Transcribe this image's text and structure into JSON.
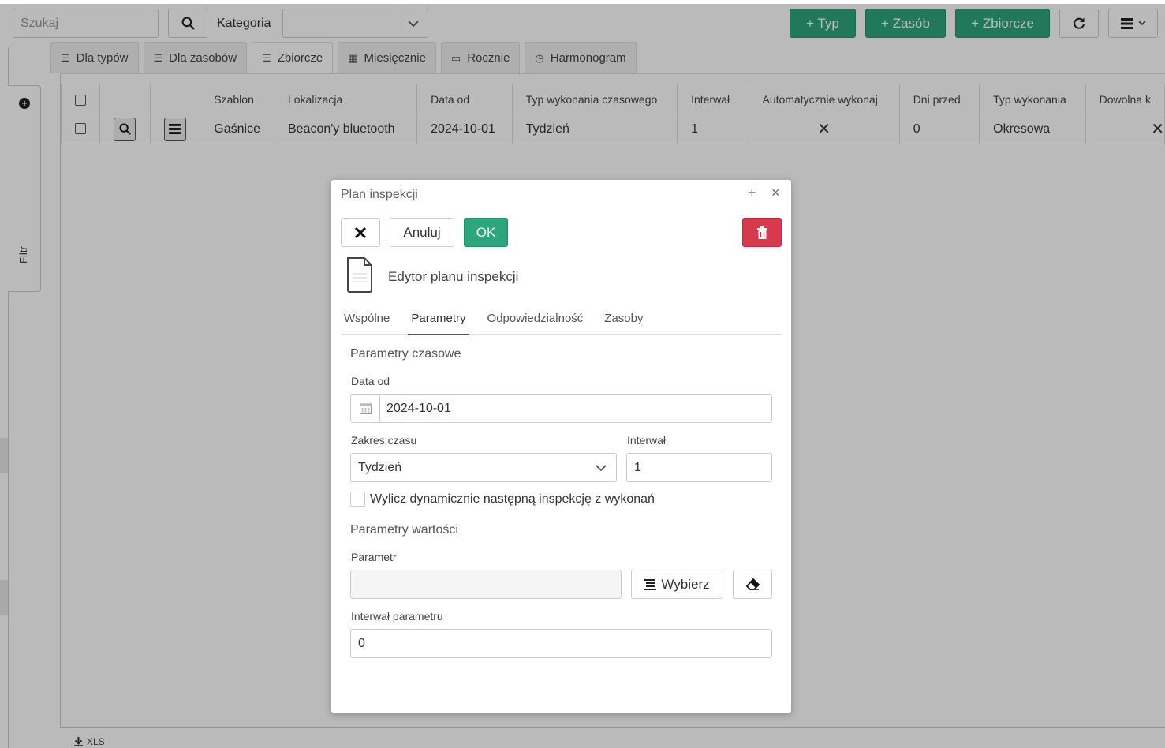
{
  "toolbar": {
    "search_placeholder": "Szukaj",
    "category_label": "Kategoria",
    "category_value": "",
    "add_type_label": "+ Typ",
    "add_resource_label": "+ Zasób",
    "add_collective_label": "+ Zbiorcze"
  },
  "sidebar": {
    "filter_label": "Filtr"
  },
  "tabs": [
    {
      "label": "Dla typów",
      "icon": "list-icon"
    },
    {
      "label": "Dla zasobów",
      "icon": "list-icon"
    },
    {
      "label": "Zbiorcze",
      "icon": "list-icon"
    },
    {
      "label": "Miesięcznie",
      "icon": "calendar-grid-icon"
    },
    {
      "label": "Rocznie",
      "icon": "calendar-icon"
    },
    {
      "label": "Harmonogram",
      "icon": "calendar-clock-icon"
    }
  ],
  "grid": {
    "headers": [
      "Szablon",
      "Lokalizacja",
      "Data od",
      "Typ wykonania czasowego",
      "Interwał",
      "Automatycznie wykonaj",
      "Dni przed",
      "Typ wykonania",
      "Dowolna k"
    ],
    "rows": [
      {
        "szablon": "Gaśnice",
        "lokalizacja": "Beacon'y bluetooth",
        "data_od": "2024-10-01",
        "typ_czasowy": "Tydzień",
        "interwal": "1",
        "auto": "✕",
        "dni_przed": "0",
        "typ_wykonania": "Okresowa",
        "dowolna": "✕"
      }
    ]
  },
  "footer": {
    "export_label": "XLS"
  },
  "modal": {
    "title": "Plan inspekcji",
    "cancel_label": "Anuluj",
    "ok_label": "OK",
    "editor_title": "Edytor planu inspekcji",
    "tabs": [
      "Wspólne",
      "Parametry",
      "Odpowiedzialność",
      "Zasoby"
    ],
    "active_tab": "Parametry",
    "time_section": "Parametry czasowe",
    "date_from_label": "Data od",
    "date_from_value": "2024-10-01",
    "time_range_label": "Zakres czasu",
    "time_range_value": "Tydzień",
    "interval_label": "Interwał",
    "interval_value": "1",
    "dynamic_checkbox_label": "Wylicz dynamicznie następną inspekcję z wykonań",
    "dynamic_checked": false,
    "value_section": "Parametry wartości",
    "parameter_label": "Parametr",
    "parameter_value": "",
    "choose_label": "Wybierz",
    "param_interval_label": "Interwał parametru",
    "param_interval_value": "0"
  },
  "colors": {
    "accent": "#2ea57c",
    "danger": "#d63a4f"
  }
}
